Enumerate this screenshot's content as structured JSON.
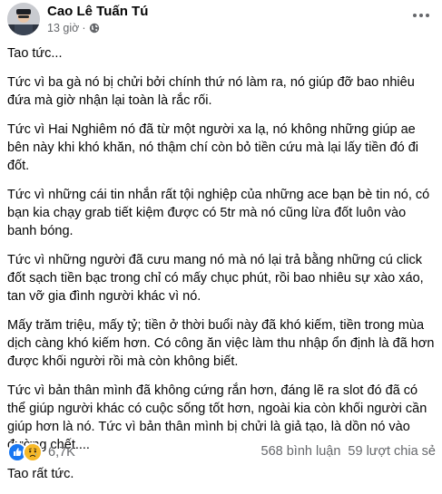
{
  "post": {
    "author": "Cao Lê Tuấn Tú",
    "time": "13 giờ",
    "separator": "·",
    "privacy_icon": "globe-icon",
    "more_icon": "ellipsis-icon",
    "paragraphs": [
      "Tao tức...",
      "Tức vì ba gà nó bị chửi bởi chính thứ nó làm ra, nó giúp đỡ bao nhiêu đứa mà giờ nhận lại toàn là rắc rối.",
      "Tức vì Hai Nghiêm nó đã từ một người xa lạ, nó không những giúp ae bên này khi khó khăn, nó thậm chí còn bỏ tiền cứu mà lại lấy tiền đó đi đốt.",
      "Tức vì những cái tin nhắn rất tội nghiệp của những ace bạn bè tin nó, có bạn kia chạy grab tiết kiệm được có 5tr mà nó cũng lừa đốt luôn vào banh bóng.",
      "Tức vì những người đã cưu mang nó mà nó lại trả bằng những cú click đốt sạch tiền bạc trong chỉ có mấy chục phút, rồi bao nhiêu sự xào xáo, tan vỡ gia đình người khác vì nó.",
      "Mấy trăm triệu, mấy tỷ; tiền ở thời buổi này đã khó kiếm, tiền trong mùa dịch càng khó kiếm hơn. Có công ăn việc làm thu nhập ổn định là đã hơn được khối người rồi mà còn không biết.",
      "Tức vì bản thân mình đã không cứng rắn hơn, đáng lẽ ra slot đó đã có thể giúp người khác có cuộc sống tốt hơn, ngoài kia còn khối người cần giúp hơn là nó. Tức vì bản thân mình bị chửi là giả tạo, là dồn nó vào đường chết....",
      "Tao rất tức."
    ]
  },
  "footer": {
    "reactions": [
      "like-icon",
      "sad-icon"
    ],
    "reaction_count": "6,7K",
    "comments": "568 bình luận",
    "shares": "59 lượt chia sẻ"
  },
  "colors": {
    "text": "#050505",
    "secondary": "#65676b",
    "like_blue": "#1877f2",
    "sad_yellow": "#f7b928"
  }
}
